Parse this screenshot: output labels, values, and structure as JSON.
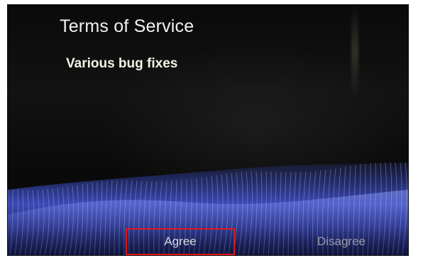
{
  "dialog": {
    "title": "Terms of Service",
    "message": "Various bug fixes"
  },
  "buttons": {
    "agree_label": "Agree",
    "disagree_label": "Disagree"
  },
  "colors": {
    "highlight_box": "#e01818",
    "wave_blue": "#3b4fd8"
  }
}
